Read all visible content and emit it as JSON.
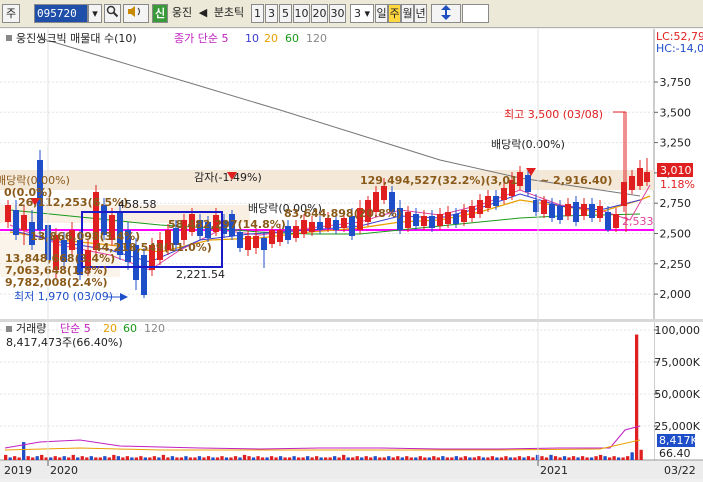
{
  "toolbar": {
    "type_label": "주",
    "code_value": "095720",
    "search_icon": "magnifier-icon",
    "speaker_icon": "speaker-icon",
    "new_badge": "신",
    "stock_name": "웅진",
    "arrow_left": "◀",
    "tick_label": "분초틱",
    "intervals": [
      "1",
      "3",
      "5",
      "10",
      "20",
      "30"
    ],
    "interval_select": "3",
    "periods": [
      "일",
      "주",
      "월",
      "년"
    ],
    "active_period": "주",
    "updown_icon": "updown-arrow-icon"
  },
  "price_panel": {
    "legend_title": "웅진씽크빅 매물대 수(10)",
    "ma_label": "종가 단순 5",
    "ma_periods": [
      "10",
      "20",
      "60",
      "120"
    ],
    "lc": "LC:52,79",
    "hc": "HC:-14,0",
    "y_ticks": [
      "3,750",
      "3,500",
      "3,250",
      "3,000",
      "2,750",
      "2,500",
      "2,250",
      "2,000"
    ],
    "current_price": "3,010",
    "current_pct": "1.18%",
    "line_label": "2,533",
    "annotations": {
      "high": "최고 3,500 (03/08)",
      "low": "최저 1,970 (03/09)",
      "dividend1": "배당락(0.00%)",
      "dividend2": "배당락(0.00%)",
      "dividend3": "배당락(0.00%)",
      "reduction": "감자(-1.49%)",
      "box_low": "2,221.54",
      "box_high": "458.58",
      "vp1": "129,494,527(32.2%)(3,01",
      "vp1b": "~ 2,916.40)",
      "vp2": "83,644,898(20.8%)",
      "vp3": "58,482,297(14.8%)",
      "vp4": "44,218,549(11.0%)",
      "vp5": "13,848,668(3.4%)",
      "vp6": "7,063,648(1.8%)",
      "vp7": "9,782,008(2.4%)",
      "vp8": "26,112,253(6.5%)",
      "vp9": "0(0.0%)",
      "vp10": "13,866,098(3.4%)"
    }
  },
  "volume_panel": {
    "legend_title": "거래량",
    "ma_label": "단순 5",
    "ma_periods": [
      "20",
      "60",
      "120"
    ],
    "info": "8,417,473주(66.40%)",
    "y_ticks": [
      "100,000",
      "75,000K",
      "50,000K",
      "25,000K"
    ],
    "current_vol": "8,417K",
    "current_pct": "66.40",
    "bar_values": [
      4,
      2,
      3,
      2,
      14,
      3,
      2,
      3,
      4,
      2,
      2,
      3,
      2,
      3,
      2,
      4,
      2,
      3,
      2,
      3,
      2,
      2,
      3,
      2,
      4,
      3,
      2,
      3,
      2,
      2,
      3,
      2,
      2,
      3,
      2,
      4,
      2,
      3,
      2,
      2,
      3,
      2,
      2,
      3,
      2,
      3,
      2,
      2,
      3,
      2,
      2,
      3,
      2,
      4,
      3,
      2,
      3,
      2,
      2,
      3,
      2,
      3,
      2,
      2,
      3,
      2,
      2,
      3,
      2,
      3,
      2,
      2,
      2,
      3,
      2,
      4,
      2,
      2,
      3,
      2,
      3,
      2,
      3,
      2,
      2,
      3,
      2,
      3,
      2,
      3,
      2,
      2,
      3,
      2,
      2,
      3,
      2,
      3,
      2,
      2,
      3,
      2,
      3,
      2,
      2,
      3,
      2,
      2,
      3,
      2,
      2,
      3,
      2,
      2,
      3,
      2,
      3,
      2,
      4,
      3,
      2,
      4,
      3,
      2,
      3,
      2,
      3,
      2,
      3,
      2,
      2,
      3,
      4,
      3,
      2,
      3,
      2,
      2,
      3,
      6,
      98,
      8
    ]
  },
  "x_axis": {
    "labels": [
      "2019",
      "2020",
      "2021",
      "03/22"
    ]
  },
  "colors": {
    "up": "#e02020",
    "down": "#1f4fc8",
    "ma5": "#e040a0",
    "ma10": "#3a3ad0",
    "ma20": "#e8a000",
    "ma60": "#1a9a1a",
    "ma120": "#888888",
    "support_line": "#ff00ff",
    "box": "#1a1ac8"
  }
}
